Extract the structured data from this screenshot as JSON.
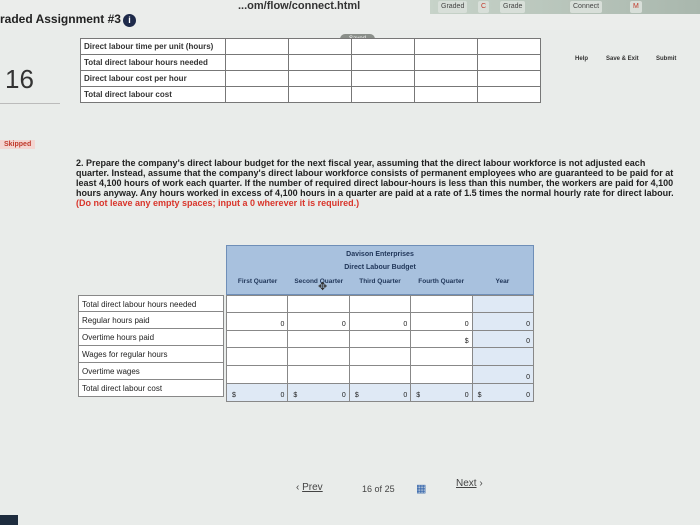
{
  "browser": {
    "url": "...om/flow/connect.html",
    "tabs": [
      "Graded",
      "C",
      "Grade",
      "Connect",
      "M"
    ]
  },
  "assignment": {
    "title": "raded Assignment #3",
    "info_icon": "i"
  },
  "question_number": "16",
  "status": {
    "saved": "Saved",
    "skipped": "Skipped"
  },
  "toolbar": {
    "help": "Help",
    "save_exit": "Save & Exit",
    "submit": "Submit"
  },
  "top_table": {
    "rows": [
      "Direct labour time per unit (hours)",
      "Total direct labour hours needed",
      "Direct labour cost per hour",
      "Total direct labour cost"
    ]
  },
  "prompt": {
    "number": "2.",
    "text": "Prepare the company's direct labour budget for the next fiscal year, assuming that the direct labour workforce is not adjusted each quarter. Instead, assume that the company's direct labour workforce consists of permanent employees who are guaranteed to be paid for at least 4,100 hours of work each quarter. If the number of required direct labour-hours is less than this number, the workers are paid for 4,100 hours anyway. Any hours worked in excess of 4,100 hours in a quarter are paid at a rate of 1.5 times the normal hourly rate for direct labour.",
    "requirement": "(Do not leave any empty spaces; input a 0 wherever it is required.)"
  },
  "budget": {
    "company": "Davison Enterprises",
    "title": "Direct Labour Budget",
    "columns": [
      "First Quarter",
      "Second Quarter",
      "Third Quarter",
      "Fourth Quarter",
      "Year"
    ],
    "row_labels": [
      "Total direct labour hours needed",
      "Regular hours paid",
      "Overtime hours paid",
      "Wages for regular hours",
      "Overtime wages",
      "Total direct labour cost"
    ],
    "values": {
      "regular_hours": [
        "0",
        "0",
        "0",
        "0",
        "0"
      ],
      "overtime_hours": [
        "",
        "",
        "",
        "$",
        "0"
      ],
      "overtime_wages": [
        "",
        "",
        "",
        "",
        "0"
      ],
      "total": [
        "$",
        "0",
        "$",
        "0",
        "$",
        "0",
        "$",
        "0",
        "$",
        "0"
      ]
    }
  },
  "pager": {
    "prev": "Prev",
    "current": "16",
    "of": "of",
    "total": "25",
    "next": "Next"
  }
}
